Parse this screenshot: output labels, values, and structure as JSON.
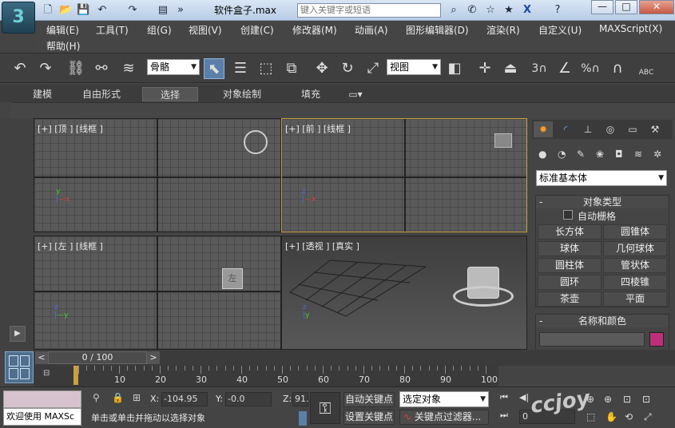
{
  "window": {
    "title": "软件盒子.max",
    "search_placeholder": "键入关键字或短语",
    "minimize": "—",
    "maximize": "□",
    "close": "✕",
    "app_logo": "3"
  },
  "menu": [
    "编辑(E)",
    "工具(T)",
    "组(G)",
    "视图(V)",
    "创建(C)",
    "修改器(M)",
    "动画(A)",
    "图形编辑器(D)",
    "渲染(R)",
    "自定义(U)",
    "MAXScript(X)",
    "帮助(H)"
  ],
  "toolbar": {
    "selection_filter": "骨骼",
    "reference_coord": "视图",
    "snap_label": "3",
    "percent_snap": "%",
    "edit_named_sel": "ABC"
  },
  "ribbon": {
    "tabs": [
      "建模",
      "自由形式",
      "选择",
      "对象绘制",
      "填充"
    ],
    "active_tab": "选择"
  },
  "viewports": {
    "top": "[+] [顶 ] [线框 ]",
    "front": "[+] [前 ] [线框 ]",
    "left": "[+] [左 ] [线框 ]",
    "perspective": "[+] [透视 ] [真实 ]"
  },
  "command_panel": {
    "category": "标准基本体",
    "object_type_header": "对象类型",
    "autogrid": "自动栅格",
    "buttons": [
      "长方体",
      "圆锥体",
      "球体",
      "几何球体",
      "圆柱体",
      "管状体",
      "圆环",
      "四棱锥",
      "茶壶",
      "平面"
    ],
    "name_color_header": "名称和颜色",
    "name_value": "",
    "object_color": "#c02e7a"
  },
  "timeline": {
    "frame_display": "0 / 100",
    "prev": "<",
    "next": ">",
    "ruler_ticks": [
      "10",
      "20",
      "30",
      "40",
      "50",
      "60",
      "70",
      "80",
      "90",
      "100"
    ]
  },
  "status": {
    "welcome": "欢迎使用 MAXSc",
    "prompt": "单击或单击并拖动以选择对象",
    "x_label": "X:",
    "x_value": "-104.95",
    "y_label": "Y:",
    "y_value": "-0.0",
    "z_label": "Z:",
    "z_value": "91.",
    "auto_key": "自动关键点",
    "set_key": "设置关键点",
    "key_mode": "选定对象",
    "key_filters": "关键点过滤器...",
    "frame_field": "0",
    "watermark": "ccjoy"
  }
}
